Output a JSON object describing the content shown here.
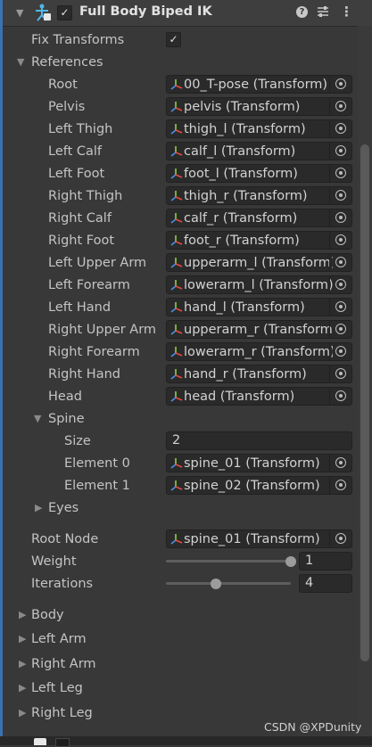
{
  "component": {
    "title": "Full Body Biped IK",
    "enabled": true,
    "icon": "biped-ik-component-icon",
    "help_icon": "help-icon",
    "preset_icon": "preset-icon",
    "menu_icon": "kebab-menu-icon"
  },
  "fix_transforms": {
    "label": "Fix Transforms",
    "checked": true
  },
  "references": {
    "label": "References",
    "expanded": true,
    "items": [
      {
        "label": "Root",
        "value": "00_T-pose (Transform)"
      },
      {
        "label": "Pelvis",
        "value": "pelvis (Transform)"
      },
      {
        "label": "Left Thigh",
        "value": "thigh_l (Transform)"
      },
      {
        "label": "Left Calf",
        "value": "calf_l (Transform)"
      },
      {
        "label": "Left Foot",
        "value": "foot_l (Transform)"
      },
      {
        "label": "Right Thigh",
        "value": "thigh_r (Transform)"
      },
      {
        "label": "Right Calf",
        "value": "calf_r (Transform)"
      },
      {
        "label": "Right Foot",
        "value": "foot_r (Transform)"
      },
      {
        "label": "Left Upper Arm",
        "value": "upperarm_l (Transform)"
      },
      {
        "label": "Left Forearm",
        "value": "lowerarm_l (Transform)"
      },
      {
        "label": "Left Hand",
        "value": "hand_l (Transform)"
      },
      {
        "label": "Right Upper Arm",
        "value": "upperarm_r (Transform)"
      },
      {
        "label": "Right Forearm",
        "value": "lowerarm_r (Transform)"
      },
      {
        "label": "Right Hand",
        "value": "hand_r (Transform)"
      },
      {
        "label": "Head",
        "value": "head (Transform)"
      }
    ],
    "spine": {
      "label": "Spine",
      "expanded": true,
      "size_label": "Size",
      "size_value": "2",
      "elements": [
        {
          "label": "Element 0",
          "value": "spine_01 (Transform)"
        },
        {
          "label": "Element 1",
          "value": "spine_02 (Transform)"
        }
      ]
    },
    "eyes": {
      "label": "Eyes",
      "expanded": false
    }
  },
  "root_node": {
    "label": "Root Node",
    "value": "spine_01 (Transform)"
  },
  "weight": {
    "label": "Weight",
    "value": "1",
    "fraction": 1.0
  },
  "iterations": {
    "label": "Iterations",
    "value": "4",
    "fraction": 0.4
  },
  "sections": [
    {
      "label": "Body",
      "expanded": false
    },
    {
      "label": "Left Arm",
      "expanded": false
    },
    {
      "label": "Right Arm",
      "expanded": false
    },
    {
      "label": "Left Leg",
      "expanded": false
    },
    {
      "label": "Right Leg",
      "expanded": false
    }
  ],
  "watermark": "CSDN @XPDunity",
  "colors": {
    "background": "#383838",
    "field": "#2a2a2a",
    "text": "#c4c4c4",
    "accent": "#3a72b0",
    "transform_x": "#e8493a",
    "transform_y": "#8bd144",
    "transform_z": "#4a8fe8"
  }
}
